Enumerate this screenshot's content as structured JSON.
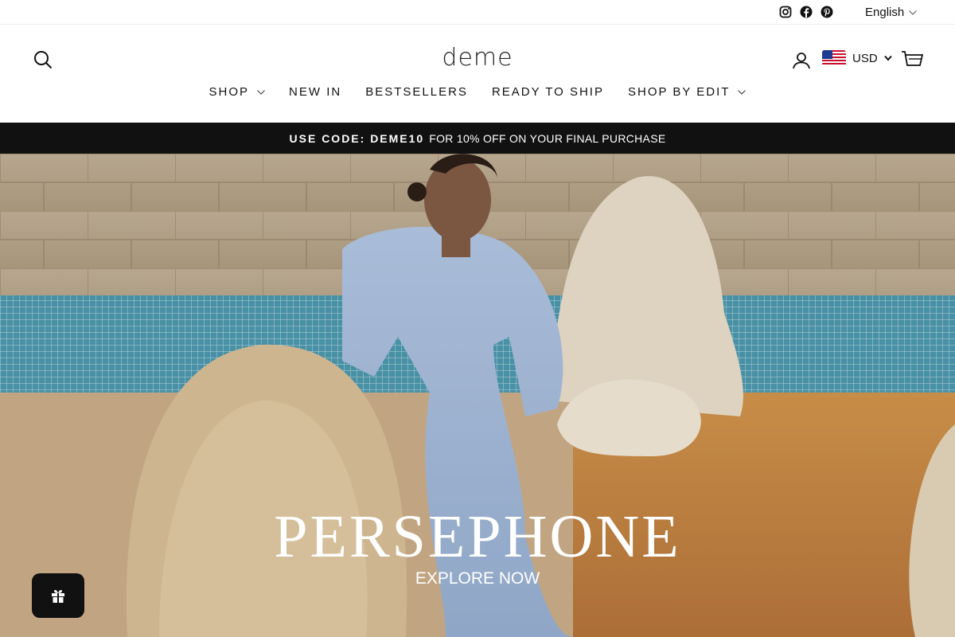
{
  "topbar": {
    "social_icons": [
      "instagram-icon",
      "facebook-icon",
      "pinterest-icon"
    ],
    "language": "English"
  },
  "header": {
    "logo": "deme",
    "currency": "USD",
    "nav": [
      {
        "label": "SHOP",
        "dropdown": true
      },
      {
        "label": "NEW IN",
        "dropdown": false
      },
      {
        "label": "BESTSELLERS",
        "dropdown": false
      },
      {
        "label": "READY TO SHIP",
        "dropdown": false
      },
      {
        "label": "SHOP BY EDIT",
        "dropdown": true
      }
    ]
  },
  "promo": {
    "code_label": "USE CODE: DEME10",
    "text": "FOR 10% OFF ON YOUR FINAL PURCHASE"
  },
  "hero": {
    "title": "PERSEPHONE",
    "cta": "EXPLORE NOW"
  },
  "colors": {
    "promo_bg": "#111111",
    "rewards_bg": "#111111"
  }
}
